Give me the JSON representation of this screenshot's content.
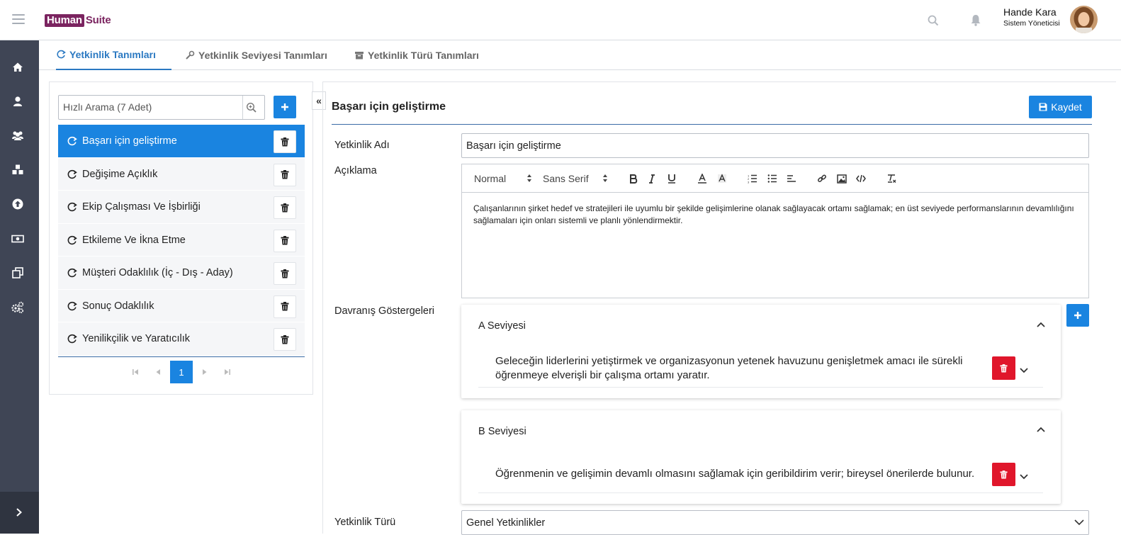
{
  "header": {
    "logo_part1": "Human",
    "logo_part2": "Suite",
    "user_name": "Hande Kara",
    "user_role": "Sistem Yöneticisi"
  },
  "sidebar": {
    "icons": [
      "home-icon",
      "user-icon",
      "users-icon",
      "cubes-icon",
      "upload-icon",
      "money-icon",
      "clone-icon",
      "cogs-icon"
    ],
    "bottom_icon": "chevron-right-icon",
    "bg_color": "#3f4555"
  },
  "tabs": [
    {
      "label": "Yetkinlik Tanımları",
      "icon": "refresh-icon",
      "active": true
    },
    {
      "label": "Yetkinlik Seviyesi Tanımları",
      "icon": "wrench-icon",
      "active": false
    },
    {
      "label": "Yetkinlik Türü Tanımları",
      "icon": "archive-icon",
      "active": false
    }
  ],
  "left_panel": {
    "search_placeholder": "Hızlı Arama (7 Adet)",
    "items": [
      {
        "label": "Başarı için geliştirme",
        "selected": true
      },
      {
        "label": "Değişime Açıklık",
        "selected": false
      },
      {
        "label": "Ekip Çalışması Ve İşbirliği",
        "selected": false
      },
      {
        "label": "Etkileme Ve İkna Etme",
        "selected": false
      },
      {
        "label": "Müşteri Odaklılık (İç - Dış - Aday)",
        "selected": false
      },
      {
        "label": "Sonuç Odaklılık",
        "selected": false
      },
      {
        "label": "Yenilikçilik ve Yaratıcılık",
        "selected": false
      }
    ],
    "pager": {
      "current_page": "1"
    }
  },
  "form": {
    "title": "Başarı için geliştirme",
    "save_label": "Kaydet",
    "name_label": "Yetkinlik Adı",
    "name_value": "Başarı için geliştirme",
    "description_label": "Açıklama",
    "editor": {
      "format_select": "Normal",
      "font_select": "Sans Serif",
      "body": "Çalışanlarının şirket hedef ve stratejileri ile uyumlu bir şekilde gelişimlerine olanak sağlayacak ortamı sağlamak; en üst seviyede performanslarının devamlılığını sağlamaları için onları sistemli ve planlı yönlendirmektir."
    },
    "indicators_label": "Davranış Göstergeleri",
    "levels": [
      {
        "title": "A Seviyesi",
        "text": "Geleceğin liderlerini yetiştirmek ve organizasyonun yetenek havuzunu genişletmek amacı ile sürekli öğrenmeye elverişli bir çalışma ortamı yaratır."
      },
      {
        "title": "B Seviyesi",
        "text": "Öğrenmenin ve gelişimin devamlı olmasını sağlamak için geribildirim verir; bireysel önerilerde bulunur."
      }
    ],
    "type_label": "Yetkinlik Türü",
    "type_value": "Genel Yetkinlikler"
  },
  "colors": {
    "accent": "#1a84e0",
    "danger": "#e0162b",
    "brand": "#7b2460"
  }
}
